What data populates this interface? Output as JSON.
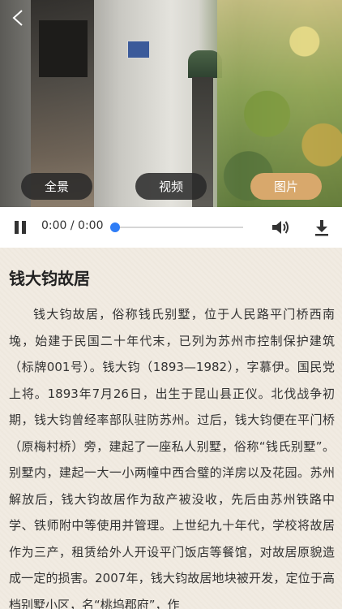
{
  "hero": {
    "back_icon": "chevron-left-icon"
  },
  "tabs": [
    {
      "label": "全景",
      "active": false
    },
    {
      "label": "视频",
      "active": false
    },
    {
      "label": "图片",
      "active": true
    }
  ],
  "colors": {
    "tab_inactive": "#2a2a2a",
    "tab_active": "#d8a86c",
    "progress_thumb": "#2f7df6",
    "page_background": "#f1ebe2"
  },
  "audio": {
    "time": "0:00 / 0:00",
    "progress": 0,
    "pause_icon": "pause-icon",
    "volume_icon": "volume-icon",
    "download_icon": "download-icon"
  },
  "article": {
    "title": "钱大钧故居",
    "body": "钱大钧故居，俗称钱氏别墅，位于人民路平门桥西南堍，始建于民国二十年代末，已列为苏州市控制保护建筑（标牌001号）。钱大钧（1893—1982），字慕伊。国民党上将。1893年7月26日，出生于昆山县正仪。北伐战争初期，钱大钧曾经率部队驻防苏州。过后，钱大钧便在平门桥（原梅村桥）旁，建起了一座私人别墅，俗称“钱氏别墅”。别墅内，建起一大一小两幢中西合璧的洋房以及花园。苏州解放后，钱大钧故居作为敌产被没收，先后由苏州铁路中学、铁师附中等使用并管理。上世纪九十年代，学校将故居作为三产，租赁给外人开设平门饭店等餐馆，对故居原貌造成一定的损害。2007年，钱大钧故居地块被开发，定位于高档别墅小区，名“桃坞郡府”，作"
  }
}
